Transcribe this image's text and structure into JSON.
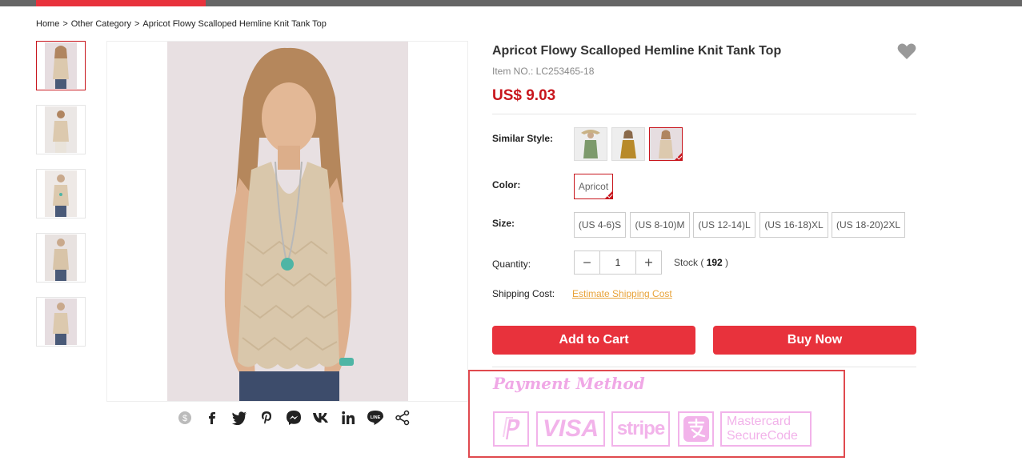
{
  "breadcrumb": {
    "home": "Home",
    "separator": ">",
    "category": "Other Category",
    "current": "Apricot Flowy Scalloped Hemline Knit Tank Top"
  },
  "product": {
    "title": "Apricot Flowy Scalloped Hemline Knit Tank Top",
    "item_no": "Item NO.: LC253465-18",
    "price": "US$ 9.03"
  },
  "similar_style": {
    "label": "Similar Style:",
    "swatches": [
      "green",
      "mustard",
      "apricot"
    ]
  },
  "color": {
    "label": "Color:",
    "selected": "Apricot"
  },
  "size": {
    "label": "Size:",
    "options": [
      "(US 4-6)S",
      "(US 8-10)M",
      "(US 12-14)L",
      "(US 16-18)XL",
      "(US 18-20)2XL"
    ]
  },
  "quantity": {
    "label": "Quantity:",
    "value": "1",
    "minus": "−",
    "plus": "+",
    "stock_prefix": "Stock ( ",
    "stock_value": "192",
    "stock_suffix": " )"
  },
  "shipping": {
    "label": "Shipping Cost:",
    "link": "Estimate Shipping Cost"
  },
  "actions": {
    "add_to_cart": "Add to Cart",
    "buy_now": "Buy Now"
  },
  "payment": {
    "title": "Payment Method",
    "methods": [
      "paypal-icon",
      "VISA",
      "stripe",
      "alipay-icon",
      "Mastercard",
      "SecureCode"
    ]
  },
  "share_icons": [
    "coin-icon",
    "facebook-icon",
    "twitter-icon",
    "pinterest-icon",
    "messenger-icon",
    "vk-icon",
    "linkedin-icon",
    "line-icon",
    "share-icon"
  ],
  "colors": {
    "accent": "#e8323c",
    "price": "#c8161d",
    "link": "#e8a33a",
    "payment": "#f2b3ea"
  }
}
